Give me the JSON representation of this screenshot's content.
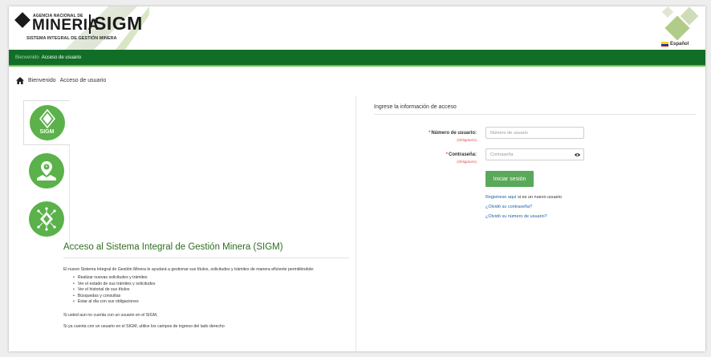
{
  "header": {
    "agency": "AGENCIA NACIONAL DE",
    "mineria": "MINERIA",
    "sigm": "SIGM",
    "system_name": "SISTEMA INTEGRAL DE GESTIÓN MINERA",
    "language": "Español"
  },
  "nav": {
    "item1": "Bienvenido",
    "item2": "Acceso de usuario"
  },
  "breadcrumb": {
    "item1": "Bienvenido",
    "item2": "Acceso de usuario"
  },
  "left": {
    "tab1_label": "SIGM",
    "title": "Acceso al Sistema Integral de Gestión Minera (SIGM)",
    "intro": "El nuevo Sistema Integral de Gestión Minera le ayudará a gestionar sus títulos, solicitudes y trámites de manera eficiente permitiéndole:",
    "bullets": [
      "Realizar nuevas solicitudes y trámites",
      "Ver el estado de sus trámites y solicitudes",
      "Ver el historial de sus títulos",
      "Búsquedas y consultas",
      "Estar al día con sus obligaciones"
    ],
    "note1": "Si usted aun no cuenta con un usuario en el SIGM,",
    "note2": "Si ya cuenta con un usuario en el SIGM, utilice los campos de ingreso del lado derecho"
  },
  "login": {
    "title": "Ingrese la información de acceso",
    "required_mark": "*",
    "username_label": "Número de usuario:",
    "username_required": "(Obligatorio)",
    "username_placeholder": "Número de usuario",
    "password_label": "Contraseña:",
    "password_required": "(Obligatorio)",
    "password_placeholder": "Contraseña",
    "submit": "Iniciar sesión",
    "register_link": "Registrese aquí",
    "register_text": "si es un nuevo usuario",
    "forgot_password": "¿Olvidó su contraseña?",
    "forgot_username": "¿Olvidó su número de usuario?"
  },
  "colors": {
    "brand_green": "#116e27",
    "accent_green": "#5bb14a",
    "button_green": "#5aa859",
    "link_blue": "#2060a8",
    "required_red": "#d9534f"
  },
  "icons": [
    "home-icon",
    "sigm-diamond-icon",
    "map-pin-icon",
    "network-diamond-icon",
    "eye-icon",
    "flag-icon"
  ]
}
